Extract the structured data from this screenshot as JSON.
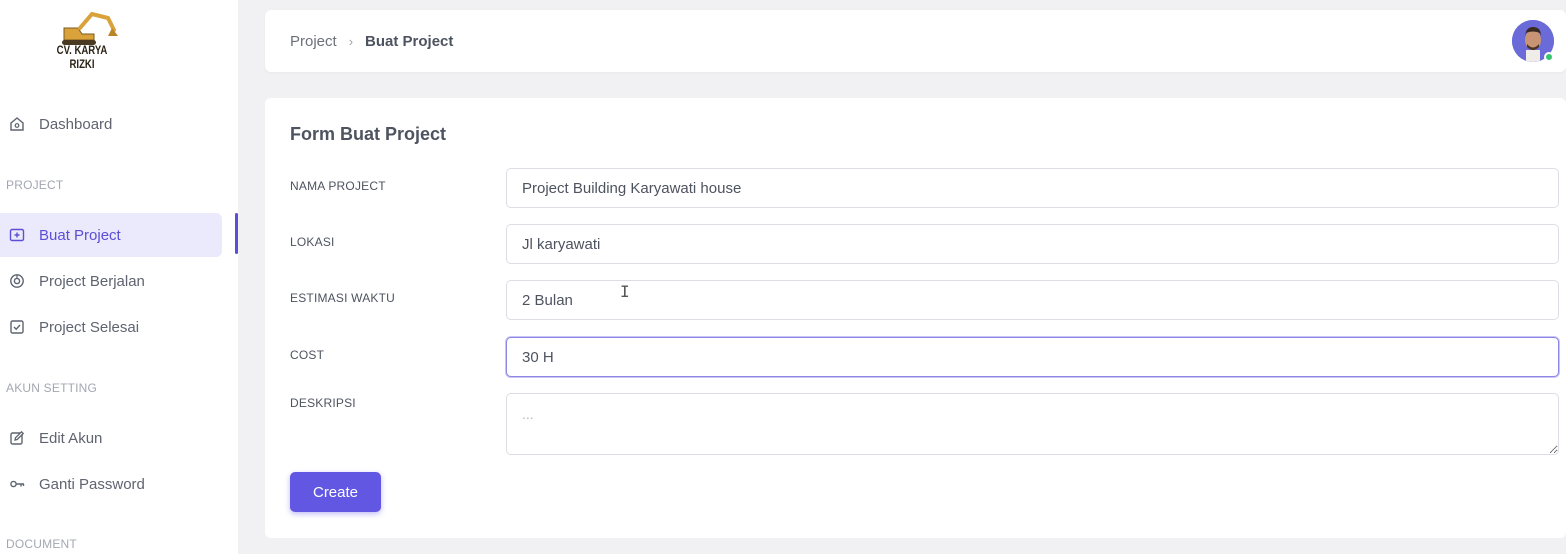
{
  "brand": {
    "logo_text": "CV. KARYA RIZKI"
  },
  "sidebar": {
    "dashboard": "Dashboard",
    "section_project": "PROJECT",
    "buat_project": "Buat Project",
    "project_berjalan": "Project Berjalan",
    "project_selesai": "Project Selesai",
    "section_akun": "AKUN SETTING",
    "edit_akun": "Edit Akun",
    "ganti_password": "Ganti Password",
    "section_document": "DOCUMENT"
  },
  "breadcrumb": {
    "parent": "Project",
    "separator": "›",
    "current": "Buat Project"
  },
  "form": {
    "title": "Form Buat Project",
    "nama_project": {
      "label": "NAMA PROJECT",
      "value": "Project Building Karyawati house"
    },
    "lokasi": {
      "label": "LOKASI",
      "value": "Jl karyawati"
    },
    "estimasi_waktu": {
      "label": "ESTIMASI WAKTU",
      "value": "2 Bulan"
    },
    "cost": {
      "label": "COST",
      "value": "30 H"
    },
    "deskripsi": {
      "label": "DESKRIPSI",
      "placeholder": "..."
    },
    "submit_label": "Create"
  },
  "colors": {
    "accent": "#6257e3",
    "active_bg": "#ebe9fc",
    "online": "#36c46f"
  }
}
